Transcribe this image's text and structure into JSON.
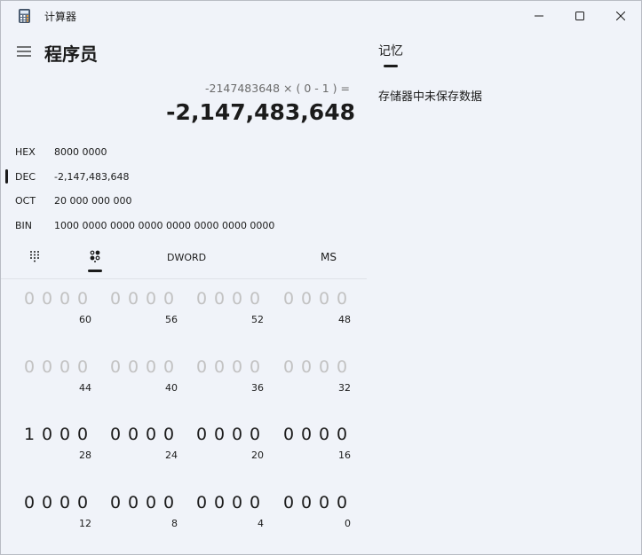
{
  "window": {
    "title": "计算器"
  },
  "header": {
    "mode": "程序员",
    "menu_icon": "hamburger-icon"
  },
  "display": {
    "expression": "-2147483648 × ( 0 - 1 ) =",
    "result": "-2,147,483,648"
  },
  "radix": [
    {
      "label": "HEX",
      "value": "8000 0000",
      "selected": false
    },
    {
      "label": "DEC",
      "value": "-2,147,483,648",
      "selected": true
    },
    {
      "label": "OCT",
      "value": "20 000 000 000",
      "selected": false
    },
    {
      "label": "BIN",
      "value": "1000 0000 0000 0000 0000 0000 0000 0000",
      "selected": false
    }
  ],
  "toolbar": {
    "keypad_icon": "full-keypad-icon",
    "bitflip_icon": "bit-flip-icon",
    "word_size": "DWORD",
    "memory_store": "MS"
  },
  "bit_groups": [
    {
      "bits": [
        "0",
        "0",
        "0",
        "0"
      ],
      "position": "60",
      "active": false
    },
    {
      "bits": [
        "0",
        "0",
        "0",
        "0"
      ],
      "position": "56",
      "active": false
    },
    {
      "bits": [
        "0",
        "0",
        "0",
        "0"
      ],
      "position": "52",
      "active": false
    },
    {
      "bits": [
        "0",
        "0",
        "0",
        "0"
      ],
      "position": "48",
      "active": false
    },
    {
      "bits": [
        "0",
        "0",
        "0",
        "0"
      ],
      "position": "44",
      "active": false
    },
    {
      "bits": [
        "0",
        "0",
        "0",
        "0"
      ],
      "position": "40",
      "active": false
    },
    {
      "bits": [
        "0",
        "0",
        "0",
        "0"
      ],
      "position": "36",
      "active": false
    },
    {
      "bits": [
        "0",
        "0",
        "0",
        "0"
      ],
      "position": "32",
      "active": false
    },
    {
      "bits": [
        "1",
        "0",
        "0",
        "0"
      ],
      "position": "28",
      "active": true
    },
    {
      "bits": [
        "0",
        "0",
        "0",
        "0"
      ],
      "position": "24",
      "active": true
    },
    {
      "bits": [
        "0",
        "0",
        "0",
        "0"
      ],
      "position": "20",
      "active": true
    },
    {
      "bits": [
        "0",
        "0",
        "0",
        "0"
      ],
      "position": "16",
      "active": true
    },
    {
      "bits": [
        "0",
        "0",
        "0",
        "0"
      ],
      "position": "12",
      "active": true
    },
    {
      "bits": [
        "0",
        "0",
        "0",
        "0"
      ],
      "position": "8",
      "active": true
    },
    {
      "bits": [
        "0",
        "0",
        "0",
        "0"
      ],
      "position": "4",
      "active": true
    },
    {
      "bits": [
        "0",
        "0",
        "0",
        "0"
      ],
      "position": "0",
      "active": true
    }
  ],
  "memory": {
    "tab_label": "记忆",
    "empty_message": "存储器中未保存数据"
  }
}
